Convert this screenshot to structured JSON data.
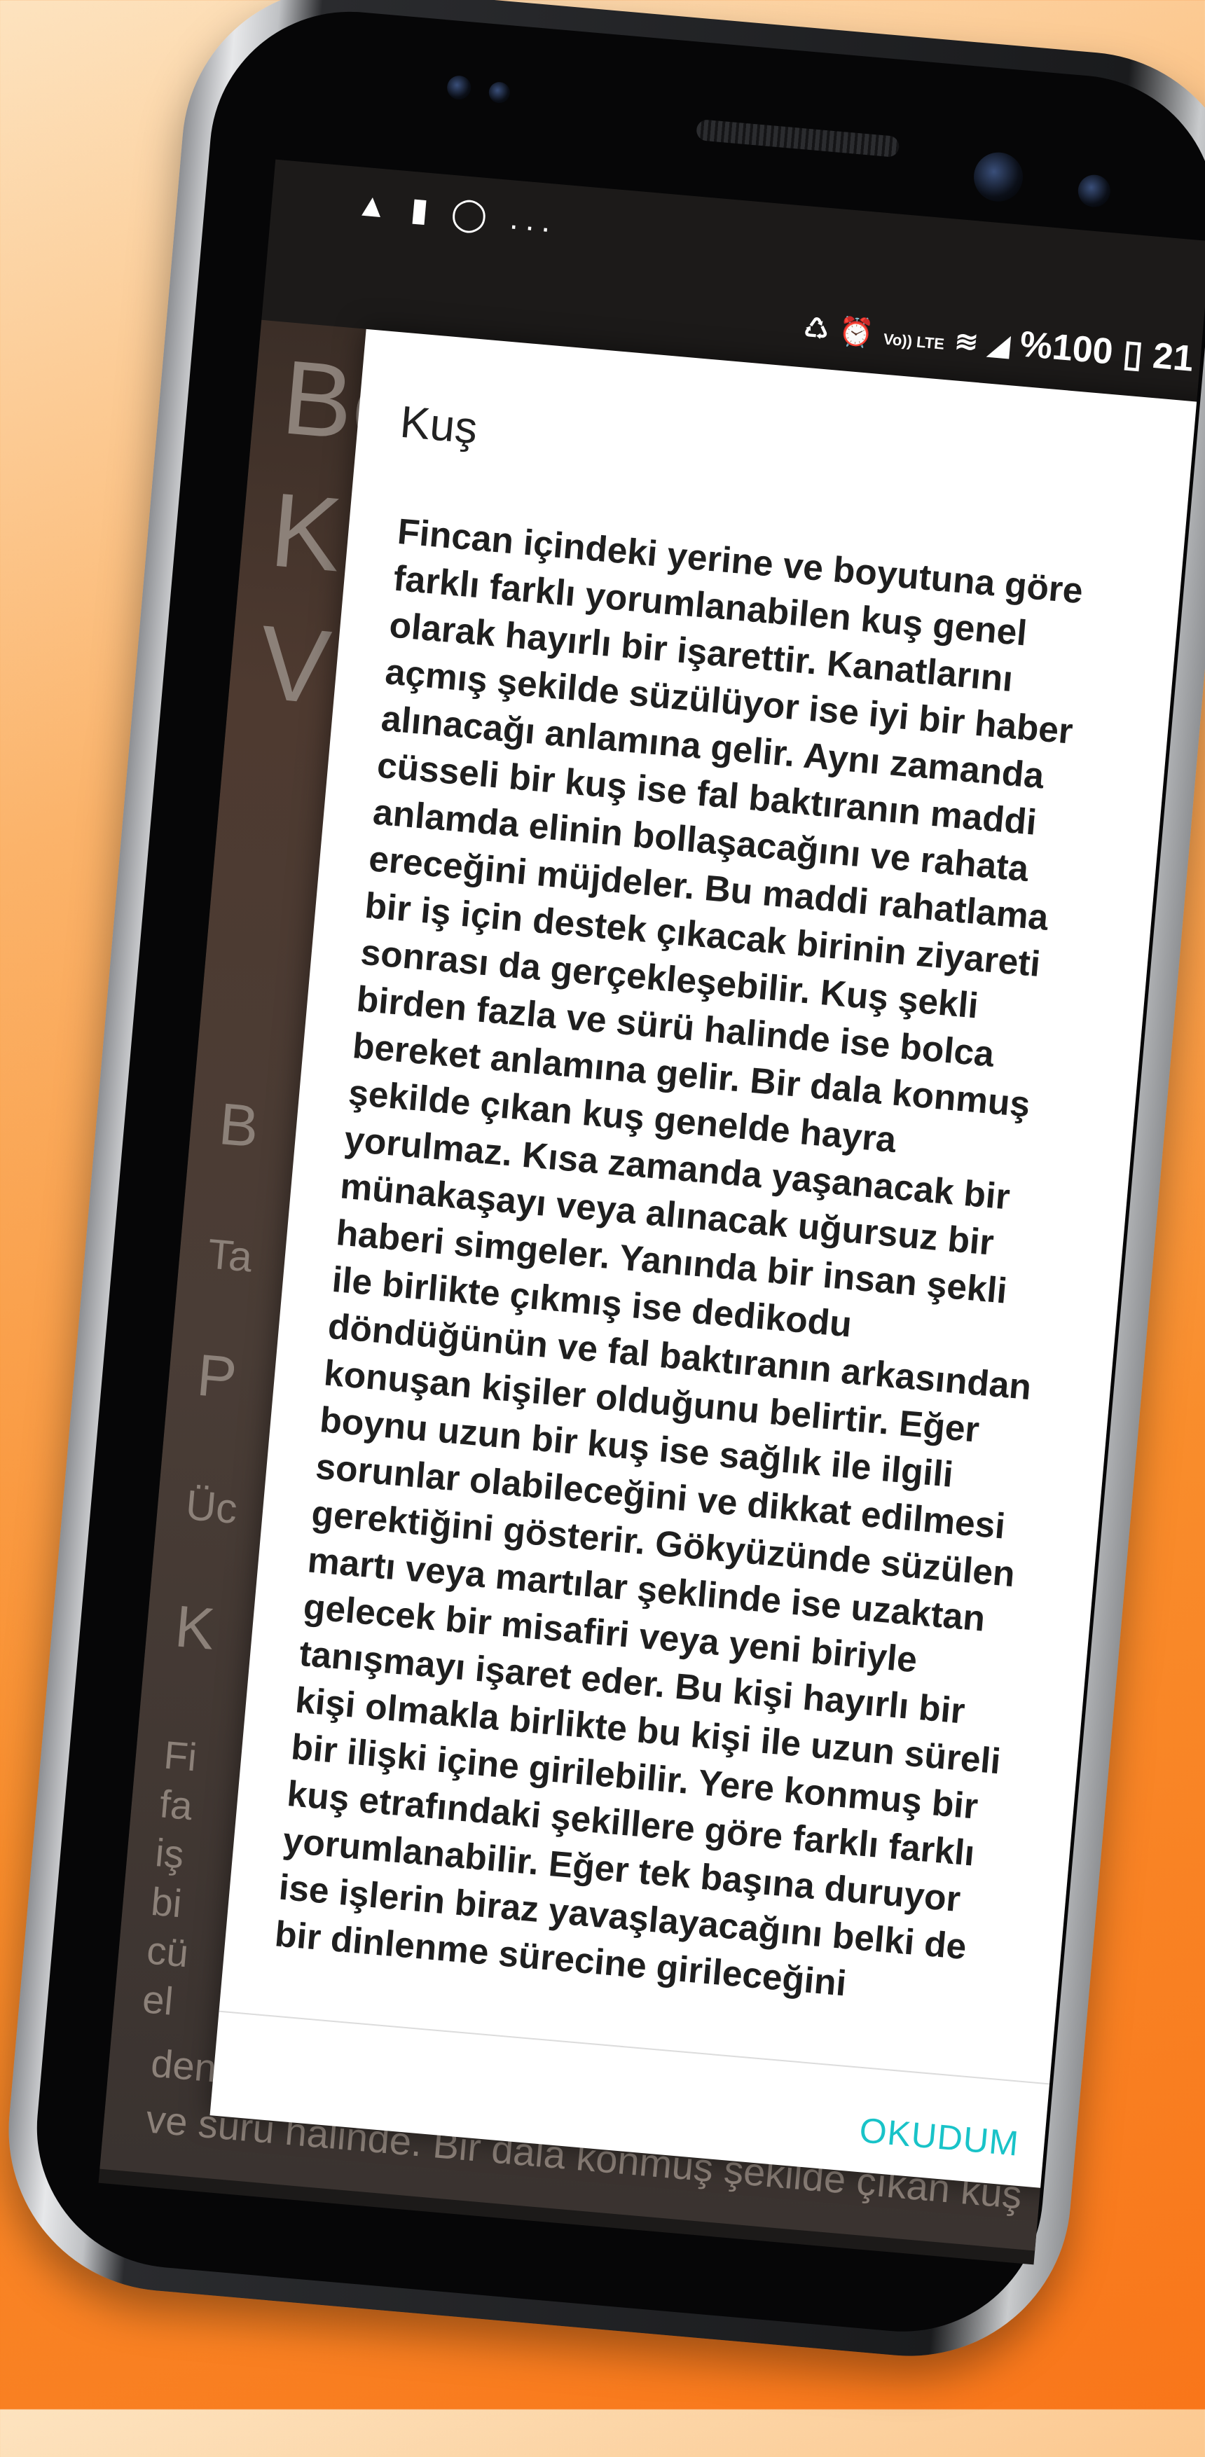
{
  "status_bar": {
    "left_icons": [
      "image-icon",
      "sim-icon",
      "sync-icon",
      "more-dots"
    ],
    "left_text": "...",
    "right_icons": [
      "battery-saver-icon",
      "alarm-icon",
      "volte-icon",
      "wifi-icon",
      "signal-icon",
      "battery-icon"
    ],
    "volte_label": "Vo)) LTE",
    "battery_percent": "%100",
    "time": "21"
  },
  "background_text": {
    "lines": [
      "Be",
      "K",
      "V",
      "B",
      "Ta",
      "P",
      "Üc",
      "K",
      "Fi",
      "fa",
      "iş",
      "bi",
      "cü",
      "el",
      "den fazla ve sürü halinde ise bolca bereket",
      "ve sürü halinde. Bir dala konmuş şekilde çıkan kuş"
    ]
  },
  "dialog": {
    "title": "Kuş",
    "body": "Fincan içindeki yerine ve boyutuna göre farklı farklı yorumlanabilen kuş genel olarak hayırlı bir işarettir. Kanatlarını açmış şekilde süzülüyor ise iyi bir haber alınacağı anlamına gelir. Aynı zamanda cüsseli bir kuş ise fal baktıranın maddi anlamda elinin bollaşacağını ve rahata ereceğini müjdeler. Bu maddi rahatlama bir iş için destek çıkacak birinin ziyareti sonrası da gerçekleşebilir. Kuş şekli birden fazla ve sürü halinde ise bolca bereket anlamına gelir. Bir dala konmuş şekilde çıkan kuş genelde hayra yorulmaz. Kısa zamanda yaşanacak bir münakaşayı veya alınacak uğursuz bir haberi simgeler. Yanında bir insan şekli ile birlikte çıkmış ise dedikodu döndüğünün ve fal baktıranın arkasından konuşan kişiler olduğunu belirtir. Eğer boynu uzun bir kuş ise sağlık ile ilgili sorunlar olabileceğini ve dikkat edilmesi gerektiğini gösterir. Gökyüzünde süzülen martı veya martılar şeklinde ise uzaktan gelecek bir misafiri veya yeni biriyle tanışmayı işaret eder. Bu kişi hayırlı bir kişi olmakla birlikte bu kişi ile uzun süreli bir ilişki içine girilebilir. Yere konmuş bir kuş etrafındaki şekillere göre farklı farklı yorumlanabilir. Eğer tek başına duruyor ise işlerin biraz yavaşlayacağını belki de bir dinlenme sürecine girileceğini",
    "confirm_label": "OKUDUM"
  },
  "colors": {
    "accent": "#19c3c8",
    "background_top": "#fde3bf",
    "background_bottom": "#f9761a"
  }
}
